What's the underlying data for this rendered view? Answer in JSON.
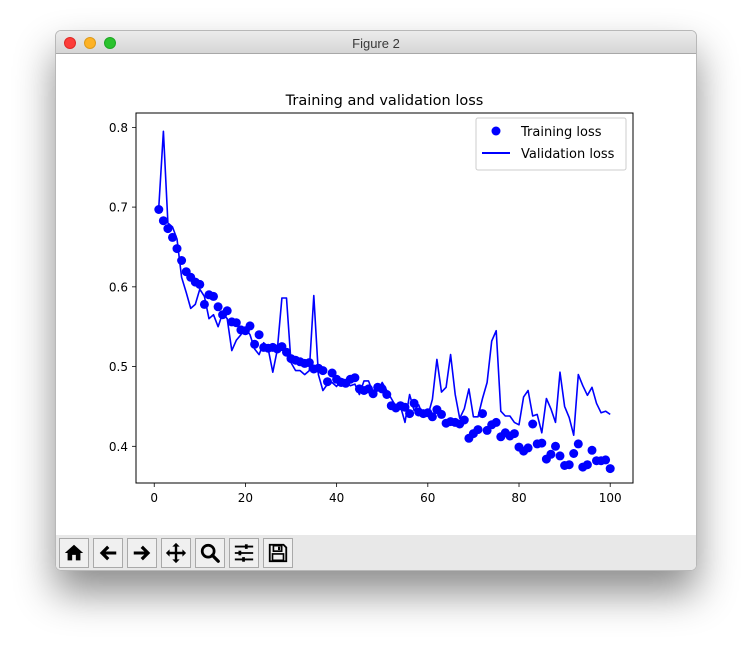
{
  "window": {
    "title": "Figure 2",
    "traffic_lights": [
      "close",
      "minimize",
      "maximize"
    ]
  },
  "toolbar": {
    "buttons": [
      {
        "name": "home",
        "icon": "home-icon"
      },
      {
        "name": "back",
        "icon": "arrow-left-icon"
      },
      {
        "name": "forward",
        "icon": "arrow-right-icon"
      },
      {
        "name": "pan",
        "icon": "move-icon"
      },
      {
        "name": "zoom",
        "icon": "magnifier-icon"
      },
      {
        "name": "configure-subplots",
        "icon": "sliders-icon"
      },
      {
        "name": "save",
        "icon": "floppy-disk-icon"
      }
    ]
  },
  "colors": {
    "series": "#0000ff",
    "axes": "#000000",
    "legend_border": "#cccccc"
  },
  "chart_data": {
    "type": "line",
    "title": "Training and validation loss",
    "xlabel": "",
    "ylabel": "",
    "xlim": [
      -4,
      105
    ],
    "ylim": [
      0.354,
      0.818
    ],
    "xticks": [
      0,
      20,
      40,
      60,
      80,
      100
    ],
    "xtick_labels": [
      "0",
      "20",
      "40",
      "60",
      "80",
      "100"
    ],
    "yticks": [
      0.4,
      0.5,
      0.6,
      0.7,
      0.8
    ],
    "ytick_labels": [
      "0.4",
      "0.5",
      "0.6",
      "0.7",
      "0.8"
    ],
    "grid": false,
    "legend": {
      "position": "top-right",
      "entries": [
        {
          "label": "Training loss",
          "style": "marker"
        },
        {
          "label": "Validation loss",
          "style": "line"
        }
      ]
    },
    "x": [
      1,
      2,
      3,
      4,
      5,
      6,
      7,
      8,
      9,
      10,
      11,
      12,
      13,
      14,
      15,
      16,
      17,
      18,
      19,
      20,
      21,
      22,
      23,
      24,
      25,
      26,
      27,
      28,
      29,
      30,
      31,
      32,
      33,
      34,
      35,
      36,
      37,
      38,
      39,
      40,
      41,
      42,
      43,
      44,
      45,
      46,
      47,
      48,
      49,
      50,
      51,
      52,
      53,
      54,
      55,
      56,
      57,
      58,
      59,
      60,
      61,
      62,
      63,
      64,
      65,
      66,
      67,
      68,
      69,
      70,
      71,
      72,
      73,
      74,
      75,
      76,
      77,
      78,
      79,
      80,
      81,
      82,
      83,
      84,
      85,
      86,
      87,
      88,
      89,
      90,
      91,
      92,
      93,
      94,
      95,
      96,
      97,
      98,
      99,
      100
    ],
    "series": [
      {
        "name": "Training loss",
        "style": "marker",
        "values": [
          0.697,
          0.683,
          0.673,
          0.662,
          0.648,
          0.633,
          0.619,
          0.612,
          0.606,
          0.603,
          0.578,
          0.59,
          0.588,
          0.575,
          0.565,
          0.57,
          0.556,
          0.555,
          0.546,
          0.545,
          0.551,
          0.528,
          0.54,
          0.524,
          0.523,
          0.524,
          0.522,
          0.525,
          0.518,
          0.51,
          0.508,
          0.506,
          0.504,
          0.505,
          0.497,
          0.498,
          0.495,
          0.481,
          0.492,
          0.484,
          0.48,
          0.479,
          0.484,
          0.486,
          0.472,
          0.47,
          0.472,
          0.466,
          0.474,
          0.472,
          0.465,
          0.451,
          0.448,
          0.451,
          0.449,
          0.441,
          0.454,
          0.443,
          0.441,
          0.442,
          0.437,
          0.446,
          0.44,
          0.429,
          0.431,
          0.43,
          0.428,
          0.433,
          0.41,
          0.416,
          0.421,
          0.441,
          0.42,
          0.427,
          0.43,
          0.412,
          0.417,
          0.413,
          0.416,
          0.399,
          0.394,
          0.398,
          0.428,
          0.403,
          0.404,
          0.384,
          0.39,
          0.4,
          0.388,
          0.376,
          0.377,
          0.391,
          0.403,
          0.374,
          0.377,
          0.395,
          0.382,
          0.382,
          0.383,
          0.372
        ]
      },
      {
        "name": "Validation loss",
        "style": "line",
        "values": [
          0.7,
          0.795,
          0.68,
          0.675,
          0.66,
          0.612,
          0.593,
          0.573,
          0.578,
          0.597,
          0.588,
          0.56,
          0.565,
          0.55,
          0.567,
          0.56,
          0.52,
          0.533,
          0.54,
          0.548,
          0.54,
          0.522,
          0.515,
          0.53,
          0.522,
          0.493,
          0.521,
          0.586,
          0.586,
          0.505,
          0.495,
          0.495,
          0.49,
          0.495,
          0.589,
          0.49,
          0.47,
          0.478,
          0.48,
          0.475,
          0.485,
          0.483,
          0.476,
          0.478,
          0.465,
          0.482,
          0.482,
          0.467,
          0.47,
          0.48,
          0.47,
          0.46,
          0.45,
          0.45,
          0.43,
          0.465,
          0.445,
          0.452,
          0.437,
          0.438,
          0.459,
          0.509,
          0.468,
          0.474,
          0.515,
          0.465,
          0.435,
          0.447,
          0.472,
          0.437,
          0.437,
          0.46,
          0.48,
          0.532,
          0.545,
          0.444,
          0.438,
          0.438,
          0.43,
          0.427,
          0.462,
          0.47,
          0.438,
          0.44,
          0.417,
          0.46,
          0.447,
          0.43,
          0.493,
          0.45,
          0.436,
          0.414,
          0.49,
          0.476,
          0.464,
          0.474,
          0.454,
          0.442,
          0.444,
          0.44
        ]
      }
    ]
  }
}
